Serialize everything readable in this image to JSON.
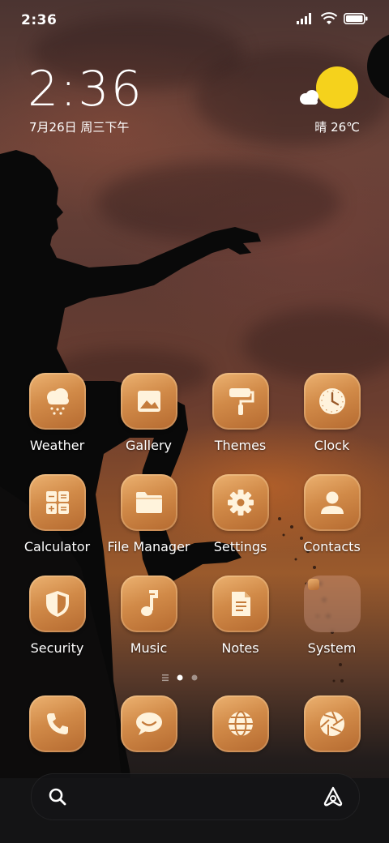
{
  "status_bar": {
    "time": "2:36",
    "icons": [
      "signal-icon",
      "wifi-icon",
      "battery-icon"
    ]
  },
  "clock_widget": {
    "time": "2:36",
    "date": "7月26日 周三下午"
  },
  "weather_widget": {
    "icon": "sunny-cloud-icon",
    "text": "晴 26℃"
  },
  "apps": [
    {
      "label": "Weather",
      "icon": "weather-icon"
    },
    {
      "label": "Gallery",
      "icon": "gallery-icon"
    },
    {
      "label": "Themes",
      "icon": "paint-roller-icon"
    },
    {
      "label": "Clock",
      "icon": "clock-icon"
    },
    {
      "label": "Calculator",
      "icon": "calculator-icon"
    },
    {
      "label": "File Manager",
      "icon": "folder-icon"
    },
    {
      "label": "Settings",
      "icon": "gear-icon"
    },
    {
      "label": "Contacts",
      "icon": "person-icon"
    },
    {
      "label": "Security",
      "icon": "shield-icon"
    },
    {
      "label": "Music",
      "icon": "music-note-icon"
    },
    {
      "label": "Notes",
      "icon": "document-icon"
    },
    {
      "label": "System",
      "icon": "folder-icon"
    }
  ],
  "page_indicator": {
    "pages": 2,
    "current": 1
  },
  "dock": [
    {
      "icon": "phone-icon"
    },
    {
      "icon": "message-icon"
    },
    {
      "icon": "globe-icon"
    },
    {
      "icon": "camera-aperture-icon"
    }
  ],
  "search_bar": {
    "icons": [
      "search-icon",
      "assistant-icon"
    ]
  },
  "colors": {
    "icon_gradient_top": "#ecb271",
    "icon_gradient_bottom": "#b56a30",
    "icon_glyph": "#fff3dc",
    "sun": "#f5d21c"
  }
}
